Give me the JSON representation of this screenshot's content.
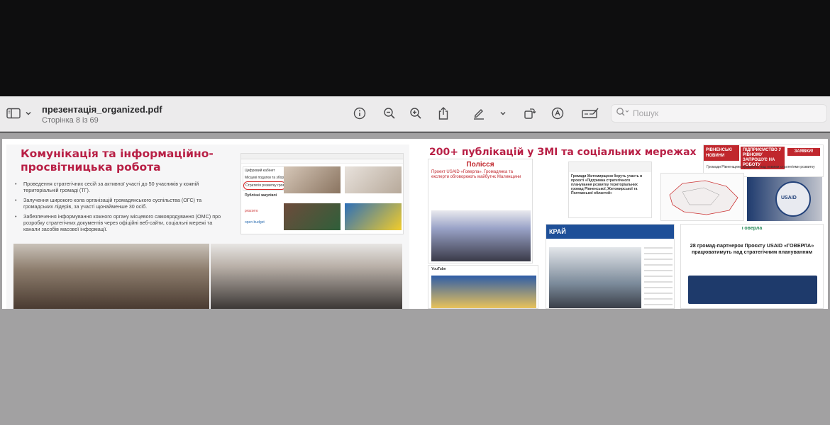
{
  "toolbar": {
    "document_title": "презентація_organized.pdf",
    "page_indicator": "Сторінка 8 із 69",
    "search_placeholder": "Пошук",
    "icons": [
      "sidebar-icon",
      "chevron-down-icon",
      "info-icon",
      "zoom-out-icon",
      "zoom-in-icon",
      "share-icon",
      "markup-pen-icon",
      "rotate-icon",
      "annotate-icon",
      "form-fill-icon",
      "search-icon"
    ]
  },
  "slide_left": {
    "title_line1": "Комунікація та інформаційно-",
    "title_line2": "просвітницька робота",
    "bullets": [
      "Проведення стратегічних сесій за активної участі до 50 учасників у кожній територіальній громаді (ТГ).",
      "Залучення широкого кола організацій громадянського суспільства (ОГС) та громадських лідерів, за участі щонайменше 30 осіб.",
      "Забезпечення інформування кожного органу місцевого самоврядування (ОМС) про розробку стратегічних документів через офіційні веб-сайти, соціальні мережі та канали засобів масової інформації."
    ],
    "website_menu": [
      "Цифровий кабінет",
      "Місцеві податки та збори",
      "Стратегія розвитку громади"
    ],
    "website_side": [
      "Публічні закупівлі",
      "prozorro",
      "open budget"
    ]
  },
  "slide_right": {
    "title": "200+ публікацій у ЗМІ та соціальних мережах",
    "outlets": [
      "Полісся",
      "РІВНЕНСЬКІ НОВИНИ",
      "КРАЙ",
      "USAID"
    ],
    "headline_polissia": "Проект USAID «Говерла». Громадянка та експерти обговорюють майбутнє Малинщини",
    "headline_usaid": "28 громад-партнерок Проєкту USAID «ГОВЕРЛА» працюватимуть над стратегічним плануванням",
    "headline_rivne": "Громади Рівненщини працюють над новими стратегіями розвитку",
    "headline_zhytomyr": "Громади Житомирщини беруть участь в проєкті «Підтримка стратегічного планування розвитку територіальних громад Рівненської, Житомирської та Полтавської областей»",
    "rivne_banner": "ПІДПРИЄМСТВО У РІВНОМУ ЗАПРОШУЄ НА РОБОТУ",
    "rivne_badge": "ЗАЯВКИ!",
    "usaid_site_tag": "Говерла",
    "youtube_label": "YouTube"
  }
}
